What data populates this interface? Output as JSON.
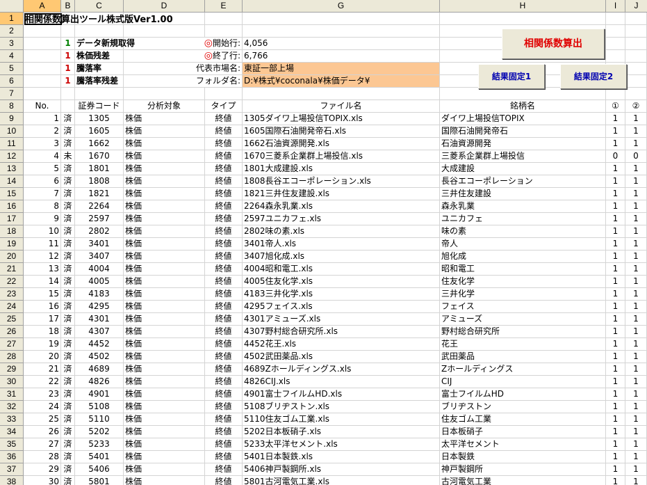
{
  "columns": [
    "A",
    "B",
    "C",
    "D",
    "E",
    "G",
    "H",
    "I",
    "J"
  ],
  "row_numbers": [
    "1",
    "2",
    "3",
    "4",
    "5",
    "6",
    "7",
    "8",
    "9",
    "10",
    "11",
    "12",
    "13",
    "14",
    "15",
    "16",
    "17",
    "18",
    "19",
    "20",
    "21",
    "22",
    "23",
    "24",
    "25",
    "26",
    "27",
    "28",
    "29",
    "30",
    "31",
    "32",
    "33",
    "34",
    "35",
    "36",
    "37",
    "38"
  ],
  "title": "相関係数算出ツール株式版Ver1.00",
  "options": [
    {
      "flag": "1",
      "flag_color": "green",
      "label": "データ新規取得"
    },
    {
      "flag": "1",
      "flag_color": "red",
      "label": "株価残差"
    },
    {
      "flag": "1",
      "flag_color": "red",
      "label": "騰落率"
    },
    {
      "flag": "1",
      "flag_color": "red",
      "label": "騰落率残差"
    }
  ],
  "params": {
    "start_mark": "◎",
    "start_label": "開始行:",
    "start_value": "4,056",
    "end_mark": "◎",
    "end_label": "終了行:",
    "end_value": "6,766",
    "market_label": "代表市場名:",
    "market_value": "東証一部上場",
    "folder_label": "フォルダ名:",
    "folder_value": "D:¥株式¥coconala¥株価データ¥"
  },
  "buttons": {
    "calc": "相関係数算出",
    "fix1": "結果固定1",
    "fix2": "結果固定2"
  },
  "headers": {
    "no": "No.",
    "code": "証券コード",
    "target": "分析対象",
    "type": "タイプ",
    "file": "ファイル名",
    "name": "銘柄名",
    "c1": "①",
    "c2": "②"
  },
  "rows": [
    {
      "no": "1",
      "st": "済",
      "code": "1305",
      "target": "株価",
      "type": "終値",
      "file": "1305ダイワ上場投信TOPIX.xls",
      "name": "ダイワ上場投信TOPIX",
      "c1": "1",
      "c2": "1"
    },
    {
      "no": "2",
      "st": "済",
      "code": "1605",
      "target": "株価",
      "type": "終値",
      "file": "1605国際石油開発帝石.xls",
      "name": "国際石油開発帝石",
      "c1": "1",
      "c2": "1"
    },
    {
      "no": "3",
      "st": "済",
      "code": "1662",
      "target": "株価",
      "type": "終値",
      "file": "1662石油資源開発.xls",
      "name": "石油資源開発",
      "c1": "1",
      "c2": "1"
    },
    {
      "no": "4",
      "st": "未",
      "code": "1670",
      "target": "株価",
      "type": "終値",
      "file": "1670三菱系企業群上場投信.xls",
      "name": "三菱系企業群上場投信",
      "c1": "0",
      "c2": "0"
    },
    {
      "no": "5",
      "st": "済",
      "code": "1801",
      "target": "株価",
      "type": "終値",
      "file": "1801大成建設.xls",
      "name": "大成建設",
      "c1": "1",
      "c2": "1"
    },
    {
      "no": "6",
      "st": "済",
      "code": "1808",
      "target": "株価",
      "type": "終値",
      "file": "1808長谷エコーポレーション.xls",
      "name": "長谷エコーポレーション",
      "c1": "1",
      "c2": "1"
    },
    {
      "no": "7",
      "st": "済",
      "code": "1821",
      "target": "株価",
      "type": "終値",
      "file": "1821三井住友建設.xls",
      "name": "三井住友建設",
      "c1": "1",
      "c2": "1"
    },
    {
      "no": "8",
      "st": "済",
      "code": "2264",
      "target": "株価",
      "type": "終値",
      "file": "2264森永乳業.xls",
      "name": "森永乳業",
      "c1": "1",
      "c2": "1"
    },
    {
      "no": "9",
      "st": "済",
      "code": "2597",
      "target": "株価",
      "type": "終値",
      "file": "2597ユニカフェ.xls",
      "name": "ユニカフェ",
      "c1": "1",
      "c2": "1"
    },
    {
      "no": "10",
      "st": "済",
      "code": "2802",
      "target": "株価",
      "type": "終値",
      "file": "2802味の素.xls",
      "name": "味の素",
      "c1": "1",
      "c2": "1"
    },
    {
      "no": "11",
      "st": "済",
      "code": "3401",
      "target": "株価",
      "type": "終値",
      "file": "3401帝人.xls",
      "name": "帝人",
      "c1": "1",
      "c2": "1"
    },
    {
      "no": "12",
      "st": "済",
      "code": "3407",
      "target": "株価",
      "type": "終値",
      "file": "3407旭化成.xls",
      "name": "旭化成",
      "c1": "1",
      "c2": "1"
    },
    {
      "no": "13",
      "st": "済",
      "code": "4004",
      "target": "株価",
      "type": "終値",
      "file": "4004昭和電工.xls",
      "name": "昭和電工",
      "c1": "1",
      "c2": "1"
    },
    {
      "no": "14",
      "st": "済",
      "code": "4005",
      "target": "株価",
      "type": "終値",
      "file": "4005住友化学.xls",
      "name": "住友化学",
      "c1": "1",
      "c2": "1"
    },
    {
      "no": "15",
      "st": "済",
      "code": "4183",
      "target": "株価",
      "type": "終値",
      "file": "4183三井化学.xls",
      "name": "三井化学",
      "c1": "1",
      "c2": "1"
    },
    {
      "no": "16",
      "st": "済",
      "code": "4295",
      "target": "株価",
      "type": "終値",
      "file": "4295フェイス.xls",
      "name": "フェイス",
      "c1": "1",
      "c2": "1"
    },
    {
      "no": "17",
      "st": "済",
      "code": "4301",
      "target": "株価",
      "type": "終値",
      "file": "4301アミューズ.xls",
      "name": "アミューズ",
      "c1": "1",
      "c2": "1"
    },
    {
      "no": "18",
      "st": "済",
      "code": "4307",
      "target": "株価",
      "type": "終値",
      "file": "4307野村総合研究所.xls",
      "name": "野村総合研究所",
      "c1": "1",
      "c2": "1"
    },
    {
      "no": "19",
      "st": "済",
      "code": "4452",
      "target": "株価",
      "type": "終値",
      "file": "4452花王.xls",
      "name": "花王",
      "c1": "1",
      "c2": "1"
    },
    {
      "no": "20",
      "st": "済",
      "code": "4502",
      "target": "株価",
      "type": "終値",
      "file": "4502武田薬品.xls",
      "name": "武田薬品",
      "c1": "1",
      "c2": "1"
    },
    {
      "no": "21",
      "st": "済",
      "code": "4689",
      "target": "株価",
      "type": "終値",
      "file": "4689Zホールディングス.xls",
      "name": "Zホールディングス",
      "c1": "1",
      "c2": "1"
    },
    {
      "no": "22",
      "st": "済",
      "code": "4826",
      "target": "株価",
      "type": "終値",
      "file": "4826CIJ.xls",
      "name": "CIJ",
      "c1": "1",
      "c2": "1"
    },
    {
      "no": "23",
      "st": "済",
      "code": "4901",
      "target": "株価",
      "type": "終値",
      "file": "4901富士フイルムHD.xls",
      "name": "富士フイルムHD",
      "c1": "1",
      "c2": "1"
    },
    {
      "no": "24",
      "st": "済",
      "code": "5108",
      "target": "株価",
      "type": "終値",
      "file": "5108ブリヂストン.xls",
      "name": "ブリヂストン",
      "c1": "1",
      "c2": "1"
    },
    {
      "no": "25",
      "st": "済",
      "code": "5110",
      "target": "株価",
      "type": "終値",
      "file": "5110住友ゴム工業.xls",
      "name": "住友ゴム工業",
      "c1": "1",
      "c2": "1"
    },
    {
      "no": "26",
      "st": "済",
      "code": "5202",
      "target": "株価",
      "type": "終値",
      "file": "5202日本板硝子.xls",
      "name": "日本板硝子",
      "c1": "1",
      "c2": "1"
    },
    {
      "no": "27",
      "st": "済",
      "code": "5233",
      "target": "株価",
      "type": "終値",
      "file": "5233太平洋セメント.xls",
      "name": "太平洋セメント",
      "c1": "1",
      "c2": "1"
    },
    {
      "no": "28",
      "st": "済",
      "code": "5401",
      "target": "株価",
      "type": "終値",
      "file": "5401日本製鉄.xls",
      "name": "日本製鉄",
      "c1": "1",
      "c2": "1"
    },
    {
      "no": "29",
      "st": "済",
      "code": "5406",
      "target": "株価",
      "type": "終値",
      "file": "5406神戸製鋼所.xls",
      "name": "神戸製鋼所",
      "c1": "1",
      "c2": "1"
    },
    {
      "no": "30",
      "st": "済",
      "code": "5801",
      "target": "株価",
      "type": "終値",
      "file": "5801古河電気工業.xls",
      "name": "古河電気工業",
      "c1": "1",
      "c2": "1"
    }
  ]
}
